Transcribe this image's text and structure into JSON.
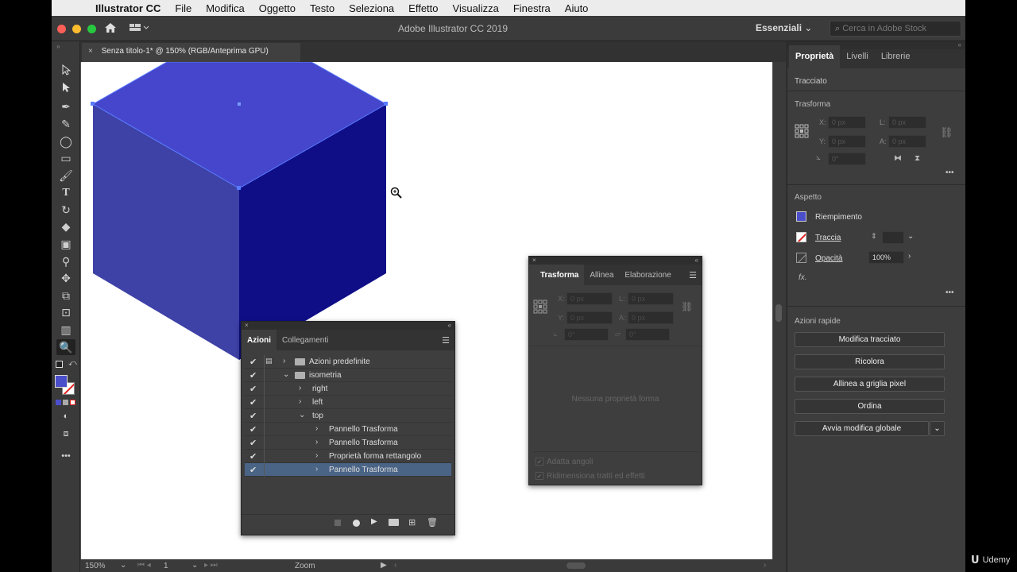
{
  "menubar": {
    "app_name": "Illustrator CC",
    "items": [
      "File",
      "Modifica",
      "Oggetto",
      "Testo",
      "Seleziona",
      "Effetto",
      "Visualizza",
      "Finestra",
      "Aiuto"
    ]
  },
  "titlebar": {
    "title": "Adobe Illustrator CC 2019",
    "workspace": "Essenziali",
    "search_placeholder": "Cerca in Adobe Stock"
  },
  "document": {
    "tab_label": "Senza titolo-1* @ 150% (RGB/Anteprima GPU)",
    "close_glyph": "×"
  },
  "colors": {
    "cube_top": "#4546cb",
    "cube_left": "#3e41a6",
    "cube_right": "#0f0e87",
    "fill_swatch": "#4b4ec9",
    "selection_accent": "#4a6486"
  },
  "actions_panel": {
    "tabs": [
      "Azioni",
      "Collegamenti"
    ],
    "rows": [
      {
        "label": "Azioni predefinite",
        "kind": "set",
        "expanded": false
      },
      {
        "label": "isometria",
        "kind": "set",
        "expanded": true
      },
      {
        "label": "right",
        "kind": "action",
        "expanded": false
      },
      {
        "label": "left",
        "kind": "action",
        "expanded": false
      },
      {
        "label": "top",
        "kind": "action",
        "expanded": true
      },
      {
        "label": "Pannello Trasforma",
        "kind": "step"
      },
      {
        "label": "Pannello Trasforma",
        "kind": "step"
      },
      {
        "label": "Proprietà forma rettangolo",
        "kind": "step"
      },
      {
        "label": "Pannello Trasforma",
        "kind": "step",
        "selected": true
      }
    ]
  },
  "transform_panel": {
    "tabs": [
      "Trasforma",
      "Allinea",
      "Elaborazione"
    ],
    "x_label": "X:",
    "y_label": "Y:",
    "w_label": "L:",
    "h_label": "A:",
    "x_value": "0 px",
    "y_value": "0 px",
    "w_value": "0 px",
    "h_value": "0 px",
    "angle_value": "0°",
    "shear_value": "0°",
    "empty_message": "Nessuna proprietà forma",
    "option_1": "Adatta angoli",
    "option_2": "Ridimensiona tratti ed effetti"
  },
  "properties": {
    "tabs": [
      "Proprietà",
      "Livelli",
      "Librerie"
    ],
    "section_path": "Tracciato",
    "section_transform": "Trasforma",
    "x_label": "X:",
    "y_label": "Y:",
    "w_label": "L:",
    "h_label": "A:",
    "x_value": "0 px",
    "y_value": "0 px",
    "w_value": "0 px",
    "h_value": "0 px",
    "angle_value": "0°",
    "section_appearance": "Aspetto",
    "fill_label": "Riempimento",
    "stroke_label": "Traccia",
    "opacity_label": "Opacità",
    "opacity_value": "100%",
    "fx_label": "fx.",
    "section_quick": "Azioni rapide",
    "quick_actions": [
      "Modifica tracciato",
      "Ricolora",
      "Allinea a griglia pixel",
      "Ordina",
      "Avvia modifica globale"
    ]
  },
  "statusbar": {
    "zoom": "150%",
    "artboard_num": "1",
    "tool_name": "Zoom"
  },
  "watermark": "Udemy"
}
